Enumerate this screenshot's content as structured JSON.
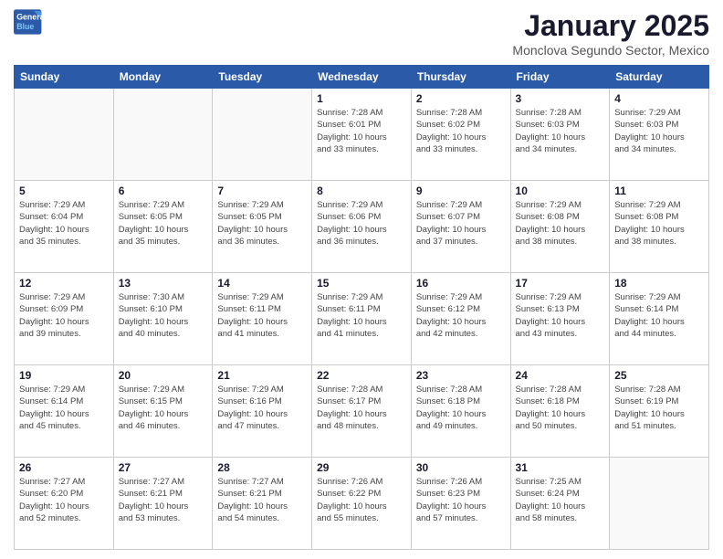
{
  "header": {
    "logo_line1": "General",
    "logo_line2": "Blue",
    "title": "January 2025",
    "subtitle": "Monclova Segundo Sector, Mexico"
  },
  "days_of_week": [
    "Sunday",
    "Monday",
    "Tuesday",
    "Wednesday",
    "Thursday",
    "Friday",
    "Saturday"
  ],
  "weeks": [
    [
      {
        "day": "",
        "info": ""
      },
      {
        "day": "",
        "info": ""
      },
      {
        "day": "",
        "info": ""
      },
      {
        "day": "1",
        "info": "Sunrise: 7:28 AM\nSunset: 6:01 PM\nDaylight: 10 hours\nand 33 minutes."
      },
      {
        "day": "2",
        "info": "Sunrise: 7:28 AM\nSunset: 6:02 PM\nDaylight: 10 hours\nand 33 minutes."
      },
      {
        "day": "3",
        "info": "Sunrise: 7:28 AM\nSunset: 6:03 PM\nDaylight: 10 hours\nand 34 minutes."
      },
      {
        "day": "4",
        "info": "Sunrise: 7:29 AM\nSunset: 6:03 PM\nDaylight: 10 hours\nand 34 minutes."
      }
    ],
    [
      {
        "day": "5",
        "info": "Sunrise: 7:29 AM\nSunset: 6:04 PM\nDaylight: 10 hours\nand 35 minutes."
      },
      {
        "day": "6",
        "info": "Sunrise: 7:29 AM\nSunset: 6:05 PM\nDaylight: 10 hours\nand 35 minutes."
      },
      {
        "day": "7",
        "info": "Sunrise: 7:29 AM\nSunset: 6:05 PM\nDaylight: 10 hours\nand 36 minutes."
      },
      {
        "day": "8",
        "info": "Sunrise: 7:29 AM\nSunset: 6:06 PM\nDaylight: 10 hours\nand 36 minutes."
      },
      {
        "day": "9",
        "info": "Sunrise: 7:29 AM\nSunset: 6:07 PM\nDaylight: 10 hours\nand 37 minutes."
      },
      {
        "day": "10",
        "info": "Sunrise: 7:29 AM\nSunset: 6:08 PM\nDaylight: 10 hours\nand 38 minutes."
      },
      {
        "day": "11",
        "info": "Sunrise: 7:29 AM\nSunset: 6:08 PM\nDaylight: 10 hours\nand 38 minutes."
      }
    ],
    [
      {
        "day": "12",
        "info": "Sunrise: 7:29 AM\nSunset: 6:09 PM\nDaylight: 10 hours\nand 39 minutes."
      },
      {
        "day": "13",
        "info": "Sunrise: 7:30 AM\nSunset: 6:10 PM\nDaylight: 10 hours\nand 40 minutes."
      },
      {
        "day": "14",
        "info": "Sunrise: 7:29 AM\nSunset: 6:11 PM\nDaylight: 10 hours\nand 41 minutes."
      },
      {
        "day": "15",
        "info": "Sunrise: 7:29 AM\nSunset: 6:11 PM\nDaylight: 10 hours\nand 41 minutes."
      },
      {
        "day": "16",
        "info": "Sunrise: 7:29 AM\nSunset: 6:12 PM\nDaylight: 10 hours\nand 42 minutes."
      },
      {
        "day": "17",
        "info": "Sunrise: 7:29 AM\nSunset: 6:13 PM\nDaylight: 10 hours\nand 43 minutes."
      },
      {
        "day": "18",
        "info": "Sunrise: 7:29 AM\nSunset: 6:14 PM\nDaylight: 10 hours\nand 44 minutes."
      }
    ],
    [
      {
        "day": "19",
        "info": "Sunrise: 7:29 AM\nSunset: 6:14 PM\nDaylight: 10 hours\nand 45 minutes."
      },
      {
        "day": "20",
        "info": "Sunrise: 7:29 AM\nSunset: 6:15 PM\nDaylight: 10 hours\nand 46 minutes."
      },
      {
        "day": "21",
        "info": "Sunrise: 7:29 AM\nSunset: 6:16 PM\nDaylight: 10 hours\nand 47 minutes."
      },
      {
        "day": "22",
        "info": "Sunrise: 7:28 AM\nSunset: 6:17 PM\nDaylight: 10 hours\nand 48 minutes."
      },
      {
        "day": "23",
        "info": "Sunrise: 7:28 AM\nSunset: 6:18 PM\nDaylight: 10 hours\nand 49 minutes."
      },
      {
        "day": "24",
        "info": "Sunrise: 7:28 AM\nSunset: 6:18 PM\nDaylight: 10 hours\nand 50 minutes."
      },
      {
        "day": "25",
        "info": "Sunrise: 7:28 AM\nSunset: 6:19 PM\nDaylight: 10 hours\nand 51 minutes."
      }
    ],
    [
      {
        "day": "26",
        "info": "Sunrise: 7:27 AM\nSunset: 6:20 PM\nDaylight: 10 hours\nand 52 minutes."
      },
      {
        "day": "27",
        "info": "Sunrise: 7:27 AM\nSunset: 6:21 PM\nDaylight: 10 hours\nand 53 minutes."
      },
      {
        "day": "28",
        "info": "Sunrise: 7:27 AM\nSunset: 6:21 PM\nDaylight: 10 hours\nand 54 minutes."
      },
      {
        "day": "29",
        "info": "Sunrise: 7:26 AM\nSunset: 6:22 PM\nDaylight: 10 hours\nand 55 minutes."
      },
      {
        "day": "30",
        "info": "Sunrise: 7:26 AM\nSunset: 6:23 PM\nDaylight: 10 hours\nand 57 minutes."
      },
      {
        "day": "31",
        "info": "Sunrise: 7:25 AM\nSunset: 6:24 PM\nDaylight: 10 hours\nand 58 minutes."
      },
      {
        "day": "",
        "info": ""
      }
    ]
  ]
}
